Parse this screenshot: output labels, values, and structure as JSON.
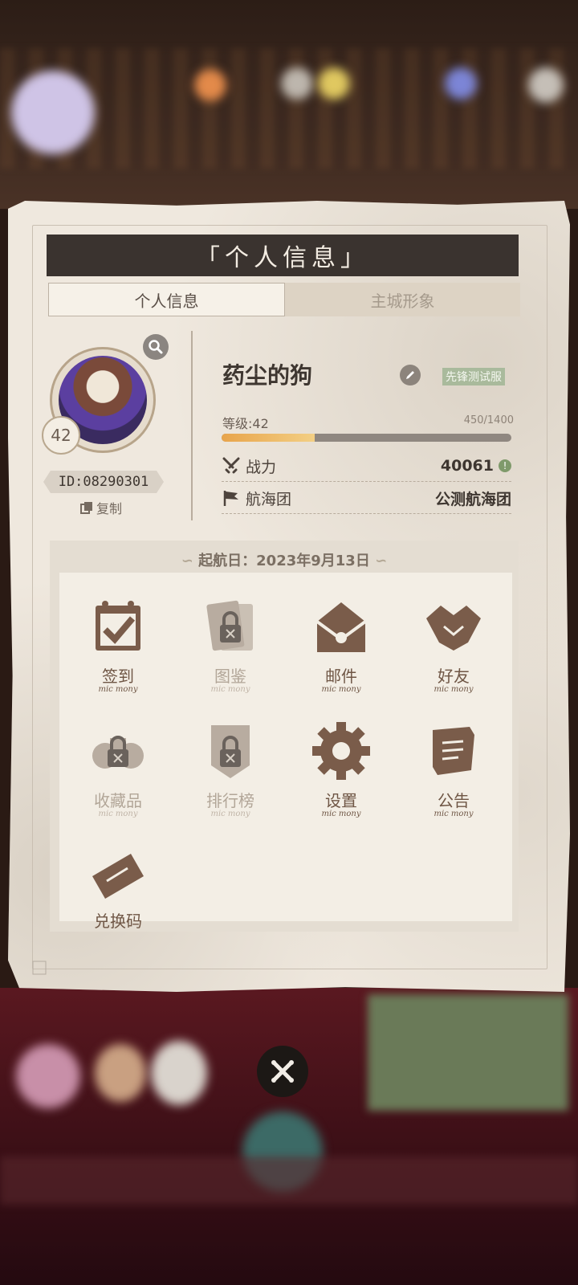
{
  "colors": {
    "accent": "#3a332f",
    "paper": "#efe8de",
    "icon_active": "#7a5c4a",
    "icon_locked": "#b8aca0",
    "exp_bar": "#e8a44b"
  },
  "panel": {
    "title": "「个人信息」"
  },
  "tabs": [
    {
      "label": "个人信息",
      "active": true
    },
    {
      "label": "主城形象",
      "active": false
    }
  ],
  "profile": {
    "name": "药尘的狗",
    "server_tag": "先锋测试服",
    "level_badge": "42",
    "id": "ID:08290301",
    "copy_label": "复制",
    "level_label": "等级:42",
    "exp": "450/1400",
    "exp_fraction": 0.32,
    "power_label": "战力",
    "power_value": "40061",
    "guild_label": "航海团",
    "guild_value": "公测航海团"
  },
  "voyage": {
    "text": "起航日：2023年9月13日"
  },
  "features": [
    {
      "label": "签到",
      "sub": "mic mony",
      "icon": "calendar-check-icon",
      "locked": false
    },
    {
      "label": "图鉴",
      "sub": "mic mony",
      "icon": "cards-lock-icon",
      "locked": true
    },
    {
      "label": "邮件",
      "sub": "mic mony",
      "icon": "mail-icon",
      "locked": false
    },
    {
      "label": "好友",
      "sub": "mic mony",
      "icon": "handshake-icon",
      "locked": false
    },
    {
      "label": "收藏品",
      "sub": "mic mony",
      "icon": "binoculars-lock-icon",
      "locked": true
    },
    {
      "label": "排行榜",
      "sub": "mic mony",
      "icon": "banner-lock-icon",
      "locked": true
    },
    {
      "label": "设置",
      "sub": "mic mony",
      "icon": "gear-icon",
      "locked": false
    },
    {
      "label": "公告",
      "sub": "mic mony",
      "icon": "scroll-icon",
      "locked": false
    },
    {
      "label": "兑换码",
      "sub": "",
      "icon": "ticket-icon",
      "locked": false
    }
  ]
}
